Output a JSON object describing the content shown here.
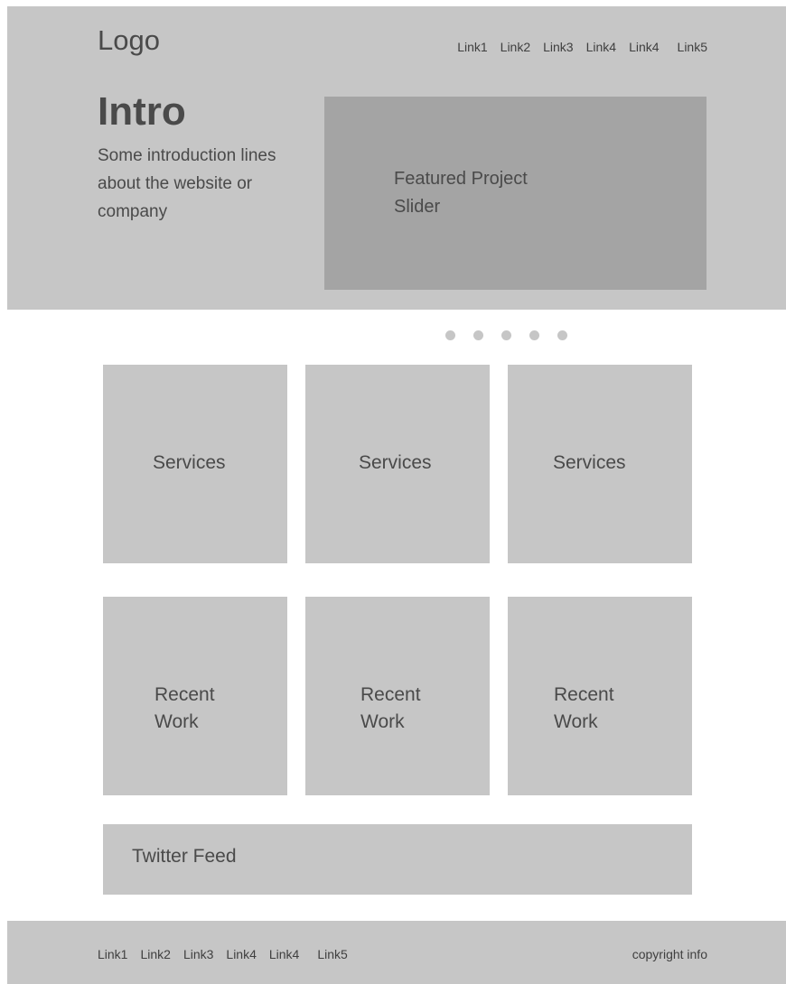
{
  "header": {
    "logo": "Logo",
    "nav": [
      "Link1",
      "Link2",
      "Link3",
      "Link4",
      "Link4",
      "Link5"
    ]
  },
  "intro": {
    "title": "Intro",
    "text": "Some introduction lines about the website or company"
  },
  "slider": {
    "label_line1": "Featured Project",
    "label_line2": "Slider",
    "dot_count": 5
  },
  "services": [
    {
      "label": "Services"
    },
    {
      "label": "Services"
    },
    {
      "label": "Services"
    }
  ],
  "recent_work": [
    {
      "line1": "Recent",
      "line2": "Work"
    },
    {
      "line1": "Recent",
      "line2": "Work"
    },
    {
      "line1": "Recent",
      "line2": "Work"
    }
  ],
  "twitter": {
    "label": "Twitter Feed"
  },
  "footer": {
    "nav": [
      "Link1",
      "Link2",
      "Link3",
      "Link4",
      "Link4",
      "Link5"
    ],
    "copyright": "copyright info"
  },
  "colors": {
    "panel": "#c6c6c6",
    "slider": "#a4a4a4",
    "text": "#4a4a4a",
    "background": "#ffffff"
  }
}
